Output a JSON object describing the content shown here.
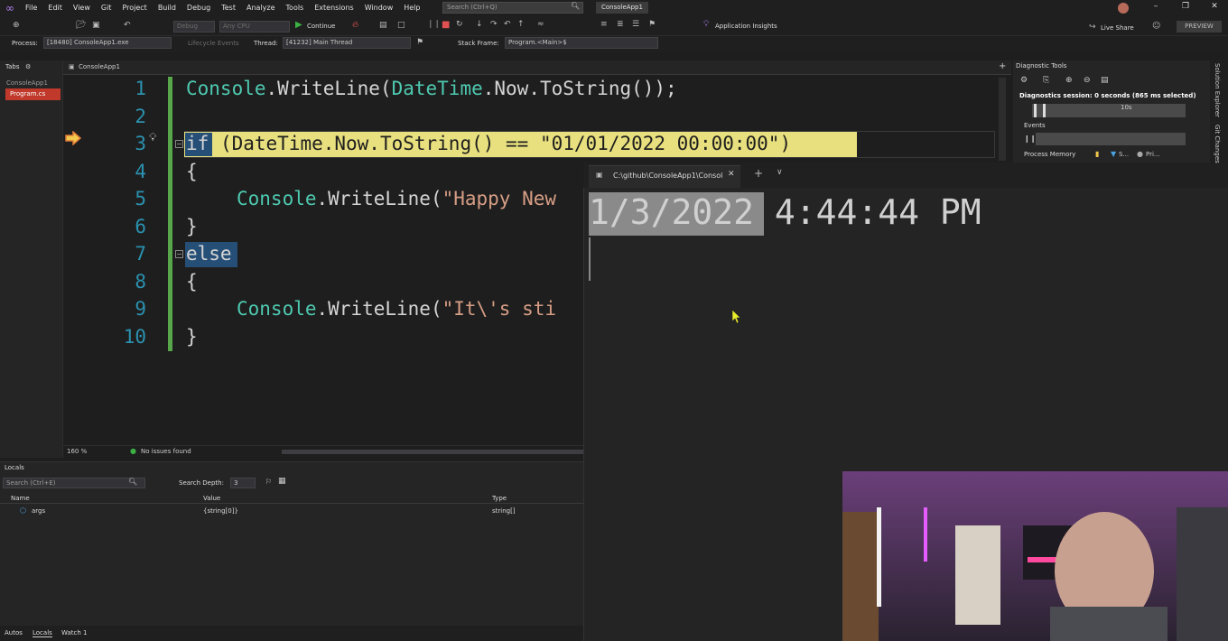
{
  "menubar": {
    "items": [
      "File",
      "Edit",
      "View",
      "Git",
      "Project",
      "Build",
      "Debug",
      "Test",
      "Analyze",
      "Tools",
      "Extensions",
      "Window",
      "Help"
    ],
    "search_placeholder": "Search (Ctrl+Q)",
    "solution_name": "ConsoleApp1"
  },
  "toolbar": {
    "config": "Debug",
    "platform": "Any CPU",
    "continue_label": "Continue",
    "app_insights": "Application Insights",
    "live_share": "Live Share",
    "preview": "PREVIEW"
  },
  "debug_bar": {
    "process_label": "Process:",
    "process_value": "[18480] ConsoleApp1.exe",
    "lifecycle": "Lifecycle Events",
    "thread_label": "Thread:",
    "thread_value": "[41232] Main Thread",
    "stackframe_label": "Stack Frame:",
    "stackframe_value": "Program.<Main>$"
  },
  "tabs_panel": {
    "title": "Tabs",
    "project": "ConsoleApp1",
    "active_file": "Program.cs"
  },
  "editor": {
    "nav_project": "ConsoleApp1",
    "zoom": "160 %",
    "issues": "No issues found",
    "lines": [
      {
        "num": "1"
      },
      {
        "num": "2"
      },
      {
        "num": "3"
      },
      {
        "num": "4"
      },
      {
        "num": "5"
      },
      {
        "num": "6"
      },
      {
        "num": "7"
      },
      {
        "num": "8"
      },
      {
        "num": "9"
      },
      {
        "num": "10"
      }
    ],
    "code": {
      "l1_cls": "Console",
      "l1_rest": ".WriteLine(",
      "l1_cls2": "DateTime",
      "l1_rest2": ".Now.ToString());",
      "l3_kw": "if",
      "l3_rest": " (DateTime.Now.ToString() == \"01/01/2022 00:00:00\")",
      "brace_open": "{",
      "brace_close": "}",
      "l5_cls": "Console",
      "l5_rest": ".WriteLine(",
      "l5_str": "\"Happy New",
      "l7_kw": "else",
      "l9_cls": "Console",
      "l9_rest": ".WriteLine(",
      "l9_str": "\"It\\'s sti"
    }
  },
  "terminal": {
    "tab_title": "C:\\github\\ConsoleApp1\\Consol",
    "output_date": "1/3/2022",
    "output_time": " 4:44:44 PM"
  },
  "diagnostics": {
    "title": "Diagnostic Tools",
    "session": "Diagnostics session: 0 seconds (865 ms selected)",
    "timeline_label": "10s",
    "events": "Events",
    "process_memory": "Process Memory",
    "legend_s": "S...",
    "legend_pri": "Pri...",
    "side_solution": "Solution Explorer",
    "side_git": "Git Changes"
  },
  "locals": {
    "title": "Locals",
    "search_placeholder": "Search (Ctrl+E)",
    "depth_label": "Search Depth:",
    "depth_value": "3",
    "col_name": "Name",
    "col_value": "Value",
    "col_type": "Type",
    "rows": [
      {
        "name": "args",
        "value": "{string[0]}",
        "type": "string[]"
      }
    ]
  },
  "bottom_tabs": [
    "Autos",
    "Locals",
    "Watch 1"
  ],
  "colors": {
    "accent": "#b180f2",
    "highlight": "#e8e07e",
    "active_tab": "#c0392b"
  }
}
